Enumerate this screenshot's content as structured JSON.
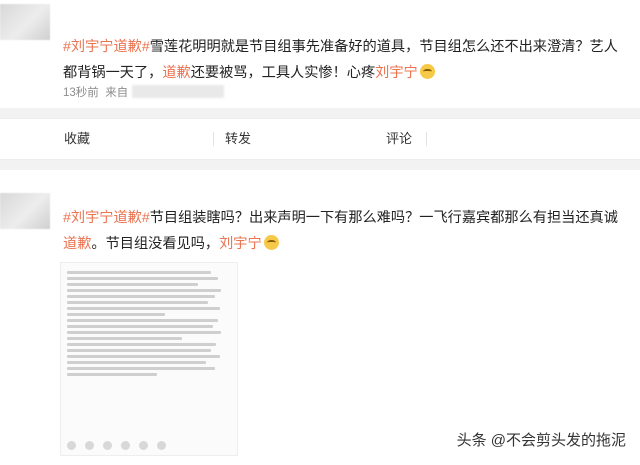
{
  "post1": {
    "hashtag": "#刘宇宁道歉#",
    "text_a": "雪莲花明明就是节目组事先准备好的道具，节目组怎么还不出来澄清？艺人都背锅一天了，",
    "highlight": "道歉",
    "text_b": "还要被骂，工具人实惨！心疼",
    "mention": "刘宇宁",
    "time": "13秒前",
    "source_label": "来自"
  },
  "actions": {
    "collect": "收藏",
    "repost": "转发",
    "comment": "评论"
  },
  "post2": {
    "hashtag": "#刘宇宁道歉#",
    "text_a": "节目组装瞎吗？出来声明一下有那么难吗？一飞行嘉宾都那么有担当还真诚",
    "highlight": "道歉",
    "text_b": "。节目组没看见吗，",
    "mention": "刘宇宁"
  },
  "watermark": "头条 @不会剪头发的拖泥",
  "colors": {
    "accent": "#eb7350",
    "text": "#222222",
    "meta": "#8c8c8c",
    "background": "#f2f2f2"
  }
}
